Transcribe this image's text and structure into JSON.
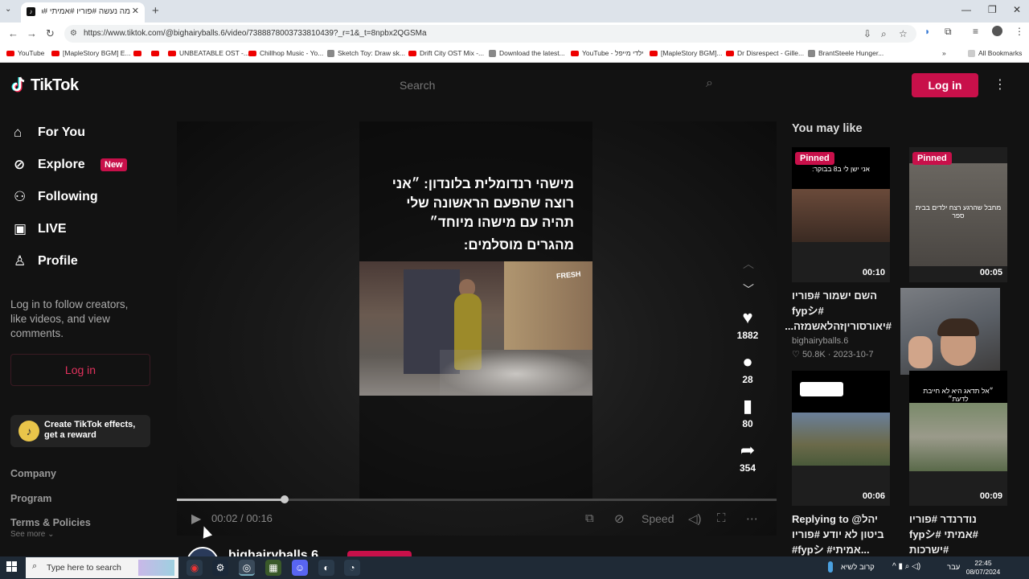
{
  "browser": {
    "tab_title": "מה נעשה #פוריו #אמיתי #fyp",
    "url": "https://www.tiktok.com/@bighairyballs.6/video/7388878003733810439?_r=1&_t=8npbx2QGSMa",
    "bookmarks": [
      {
        "label": "YouTube",
        "type": "yt"
      },
      {
        "label": "[MapleStory BGM] E...",
        "type": "yt"
      },
      {
        "label": "",
        "type": "yt"
      },
      {
        "label": "",
        "type": "yt"
      },
      {
        "label": "UNBEATABLE OST -...",
        "type": "yt"
      },
      {
        "label": "Chillhop Music - Yo...",
        "type": "yt"
      },
      {
        "label": "Sketch Toy: Draw sk...",
        "type": "gen"
      },
      {
        "label": "Drift City OST Mix -...",
        "type": "yt"
      },
      {
        "label": "Download the latest...",
        "type": "gen"
      },
      {
        "label": "YouTube - ילדי מייפל",
        "type": "yt"
      },
      {
        "label": "[MapleStory BGM]...",
        "type": "yt"
      },
      {
        "label": "Dr Disrespect - Gille...",
        "type": "yt"
      },
      {
        "label": "BrantSteele Hunger...",
        "type": "gen"
      }
    ],
    "all_bookmarks": "All Bookmarks"
  },
  "tiktok": {
    "logo": "TikTok",
    "search_placeholder": "Search",
    "login_top": "Log in",
    "nav": {
      "for_you": "For You",
      "explore": "Explore",
      "explore_badge": "New",
      "following": "Following",
      "live": "LIVE",
      "profile": "Profile"
    },
    "side_hint": "Log in to follow creators, like videos, and view comments.",
    "login_side": "Log in",
    "effects": "Create TikTok effects, get a reward",
    "footer": {
      "company": "Company",
      "program": "Program",
      "terms": "Terms & Policies",
      "see_more": "See more"
    }
  },
  "video": {
    "caption_line": "מישהי רנדומלית בלונדון: ״אני רוצה שהפעם הראשונה שלי תהיה עם מישהו מיוחד״",
    "caption_line2": "מהגרים מוסלמים:",
    "clip_sign": "FRESH",
    "likes": "1882",
    "comments": "28",
    "saves": "80",
    "shares": "354",
    "time": "00:02 / 00:16",
    "progress_fraction": 0.18,
    "speed_label": "Speed",
    "author": "bighairyballs.6"
  },
  "recommended": {
    "heading": "You may like",
    "cards": [
      {
        "pinned": "Pinned",
        "overlay": "אני ישן לי ב8 בבוקר:",
        "duration": "00:10",
        "title": "השם ישמור #פוריו #fypシ #יאורסוריןזהלאשמזה...",
        "author": "bighairyballs.6",
        "likes": "50.8K",
        "date": "2023-10-7"
      },
      {
        "pinned": "Pinned",
        "overlay": "מחבל שהרגע רצח ילדים בבית ספר",
        "duration": "00:05"
      },
      {
        "overlay": "",
        "duration": "00:06",
        "title": "Replying to @יהל ביטון לא יודע #פוריו #fypシ #אמיתי..."
      },
      {
        "overlay": "״אל תדאג היא לא חייבת לדעת״",
        "duration": "00:09",
        "title": "נודרנדר #פוריו #אמיתי #fypシ #ישרכות #חרבותברזל..."
      }
    ]
  },
  "taskbar": {
    "search_placeholder": "Type here to search",
    "tray_text": "קרוב לשיא",
    "lang": "עבר",
    "time": "22:45",
    "date": "08/07/2024"
  }
}
